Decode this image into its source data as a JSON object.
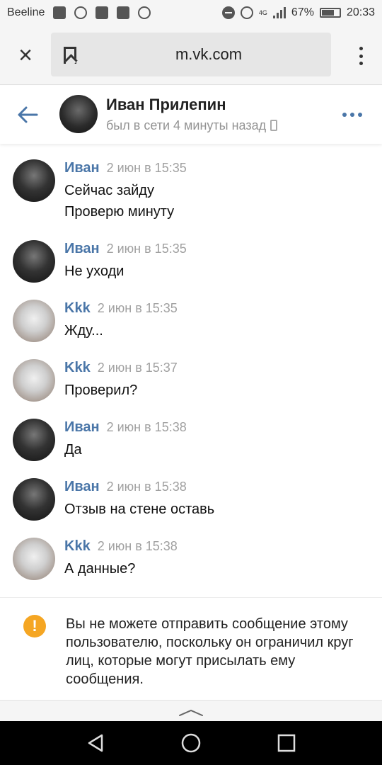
{
  "status_bar": {
    "carrier": "Beeline",
    "network": "4G",
    "battery": "67%",
    "battery_level": 0.67,
    "time": "20:33"
  },
  "browser": {
    "url": "m.vk.com",
    "icons": [
      "close-icon",
      "bookmark-icon",
      "more-vert-icon"
    ]
  },
  "header": {
    "name": "Иван Прилепин",
    "status": "был в сети 4 минуты назад",
    "icons": [
      "back-arrow-icon",
      "phone-icon",
      "more-horiz-icon"
    ]
  },
  "messages": [
    {
      "author": "Иван",
      "time": "2 июн в 15:35",
      "lines": [
        "Сейчас зайду",
        "Проверю минуту"
      ]
    },
    {
      "author": "Иван",
      "time": "2 июн в 15:35",
      "lines": [
        "Не уходи"
      ]
    },
    {
      "author": "Kkk",
      "time": "2 июн в 15:35",
      "lines": [
        "Жду..."
      ]
    },
    {
      "author": "Kkk",
      "time": "2 июн в 15:37",
      "lines": [
        "Проверил?"
      ]
    },
    {
      "author": "Иван",
      "time": "2 июн в 15:38",
      "lines": [
        "Да"
      ]
    },
    {
      "author": "Иван",
      "time": "2 июн в 15:38",
      "lines": [
        "Отзыв на стене оставь"
      ]
    },
    {
      "author": "Kkk",
      "time": "2 июн в 15:38",
      "lines": [
        "А данные?"
      ]
    }
  ],
  "warning": {
    "icon": "!",
    "text": "Вы не можете отправить сообщение этому пользователю, поскольку он ограничил круг лиц, которые могут присылать ему сообщения."
  },
  "colors": {
    "accent": "#4a76a8",
    "warning": "#f5a623",
    "muted": "#939393"
  }
}
